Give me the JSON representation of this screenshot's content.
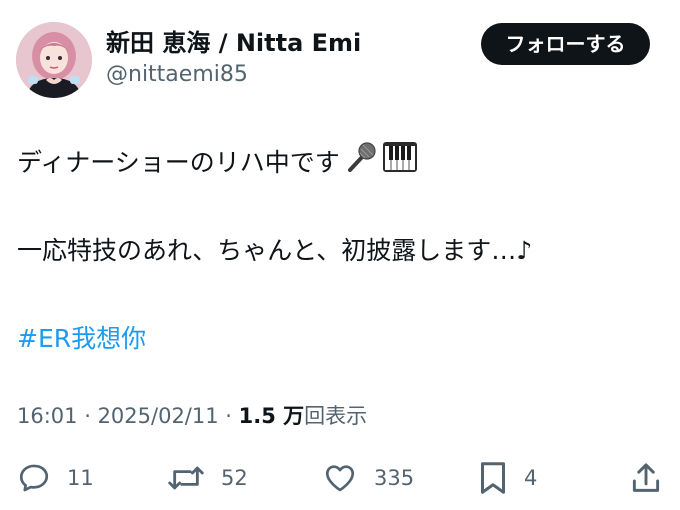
{
  "author": {
    "display_name": "新田 恵海 / Nitta Emi",
    "handle": "@nittaemi85"
  },
  "follow_button": {
    "label": "フォローする"
  },
  "tweet": {
    "line1": "ディナーショーのリハ中です",
    "line1_emojis": [
      "microphone-emoji",
      "piano-keys-emoji"
    ],
    "line2": "一応特技のあれ、ちゃんと、初披露します…♪",
    "hashtag": "#ER我想你"
  },
  "meta": {
    "time": "16:01",
    "sep1": " · ",
    "date": "2025/02/11",
    "sep2": " · ",
    "views_count": "1.5 万",
    "views_label": "回表示"
  },
  "actions": {
    "reply_count": "11",
    "repost_count": "52",
    "like_count": "335",
    "bookmark_count": "4"
  },
  "colors": {
    "text": "#0f1419",
    "secondary": "#536471",
    "link": "#1d9bf0",
    "button": "#0f1419"
  }
}
